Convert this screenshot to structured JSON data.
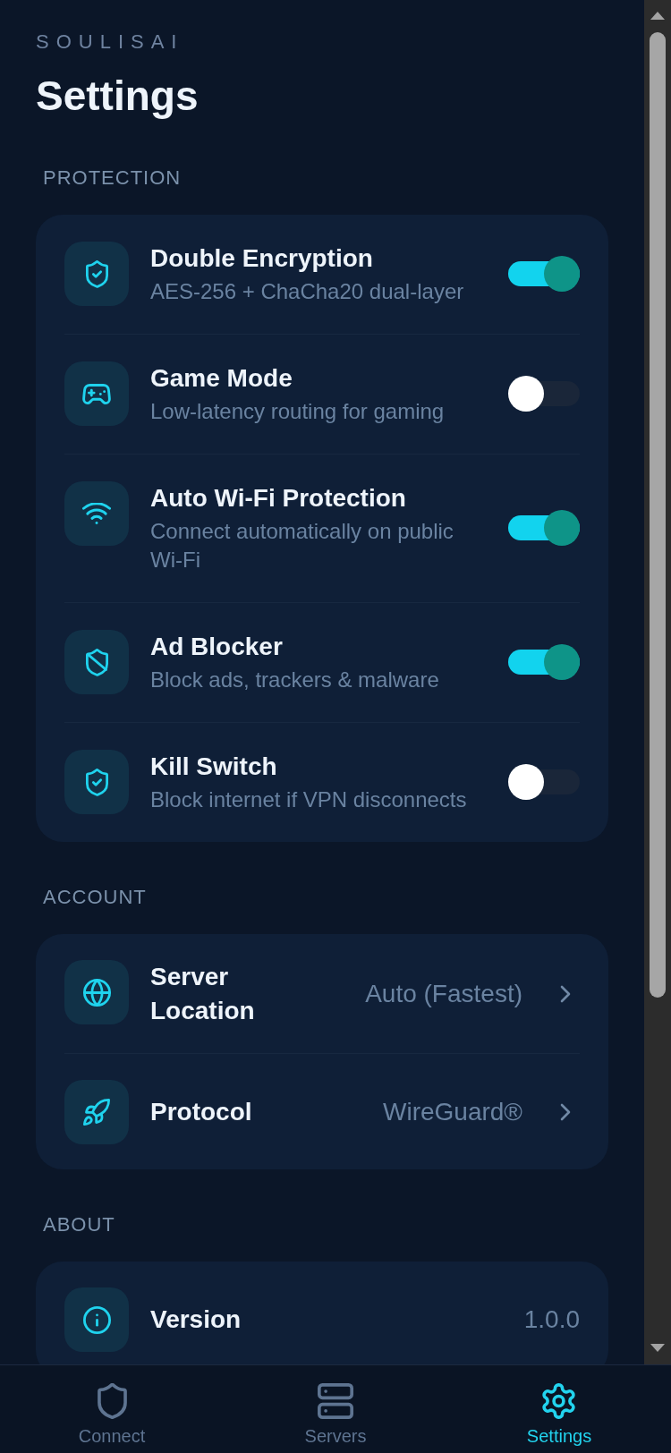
{
  "header": {
    "brand": "SOULISAI",
    "title": "Settings"
  },
  "sections": [
    {
      "label": "PROTECTION",
      "items": [
        {
          "kind": "toggle",
          "title": "Double Encryption",
          "description": "AES-256 + ChaCha20 dual-layer",
          "on": true
        },
        {
          "kind": "toggle",
          "title": "Game Mode",
          "description": "Low-latency routing for gaming",
          "on": false
        },
        {
          "kind": "toggle",
          "title": "Auto Wi-Fi Protection",
          "description": "Connect automatically on public Wi-Fi",
          "on": true
        },
        {
          "kind": "toggle",
          "title": "Ad Blocker",
          "description": "Block ads, trackers & malware",
          "on": true
        },
        {
          "kind": "toggle",
          "title": "Kill Switch",
          "description": "Block internet if VPN disconnects",
          "on": false
        }
      ]
    },
    {
      "label": "ACCOUNT",
      "items": [
        {
          "kind": "link",
          "title": "Server Location",
          "value": "Auto (Fastest)"
        },
        {
          "kind": "link",
          "title": "Protocol",
          "value": "WireGuard®"
        }
      ]
    },
    {
      "label": "ABOUT",
      "items": [
        {
          "kind": "info",
          "title": "Version",
          "value": "1.0.0"
        }
      ]
    }
  ],
  "bottom_nav": [
    {
      "label": "Connect",
      "selected": false
    },
    {
      "label": "Servers",
      "selected": false
    },
    {
      "label": "Settings",
      "selected": true
    }
  ]
}
